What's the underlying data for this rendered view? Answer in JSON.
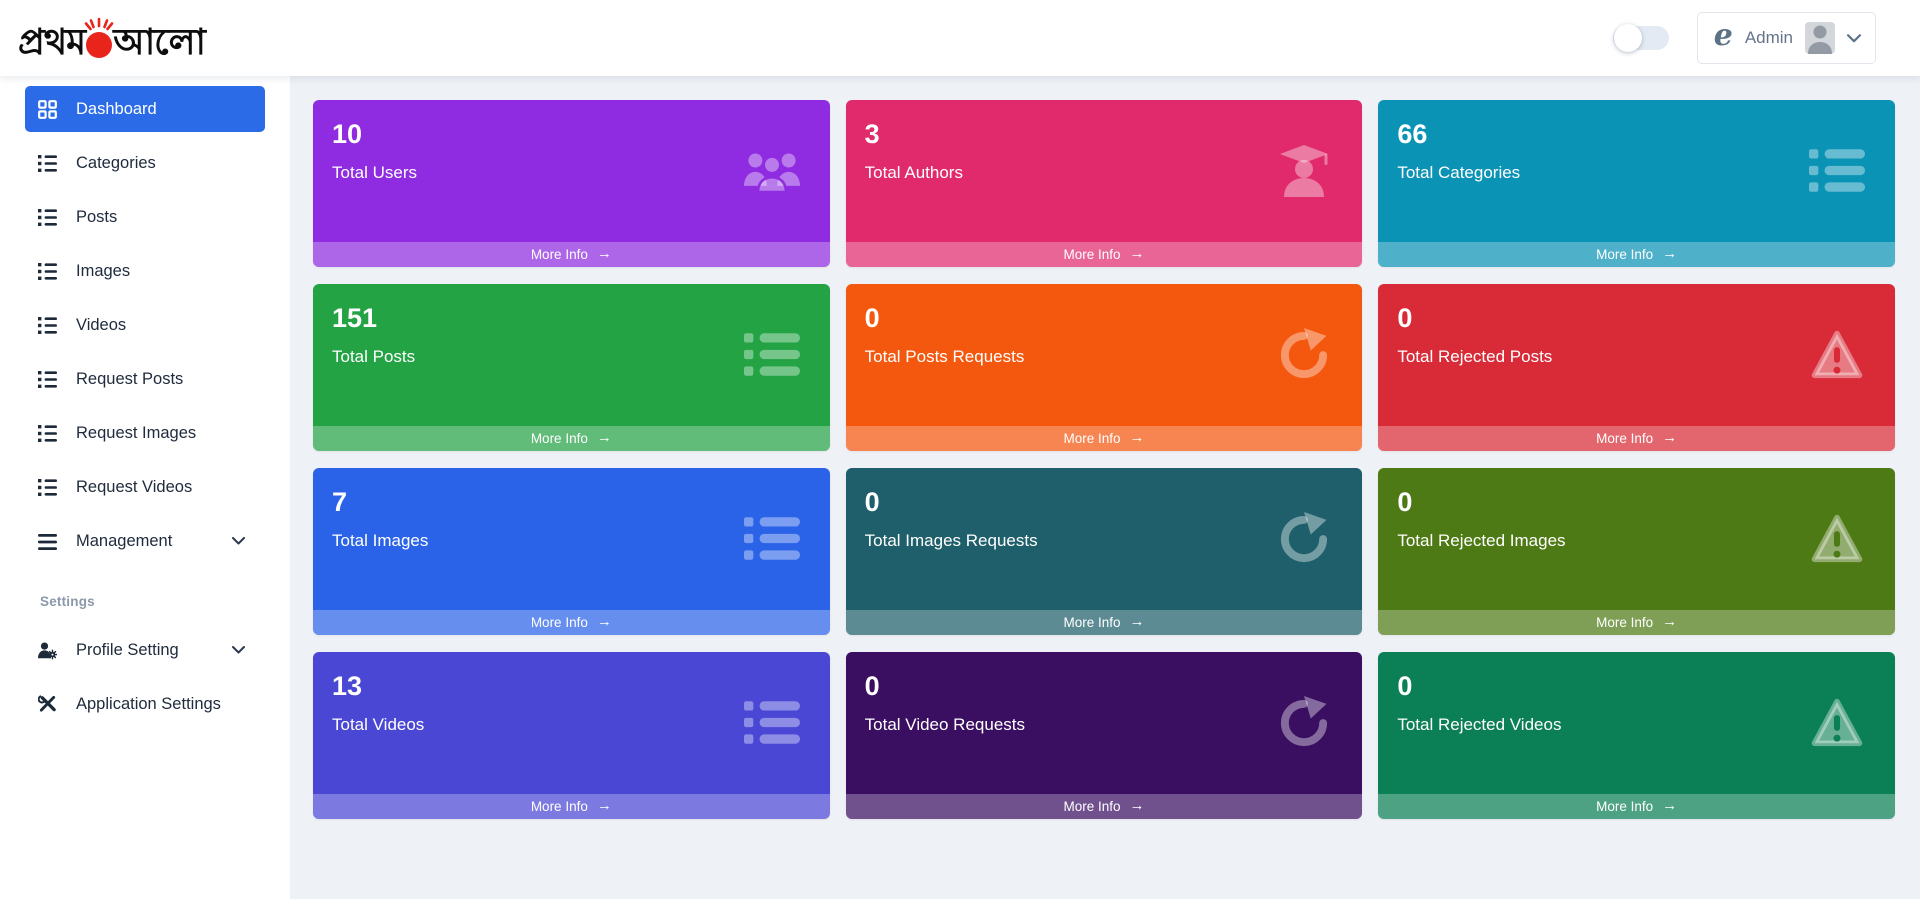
{
  "brand": {
    "text_left": "প্রথম",
    "text_right": "আলো",
    "sun_color": "#e8241b"
  },
  "header": {
    "admin_label": "Admin"
  },
  "sidebar": {
    "active_color": "#2b6be8",
    "items": [
      {
        "label": "Dashboard"
      },
      {
        "label": "Categories"
      },
      {
        "label": "Posts"
      },
      {
        "label": "Images"
      },
      {
        "label": "Videos"
      },
      {
        "label": "Request Posts"
      },
      {
        "label": "Request Images"
      },
      {
        "label": "Request Videos"
      },
      {
        "label": "Management"
      }
    ],
    "section_label": "Settings",
    "settings_items": [
      {
        "label": "Profile Setting"
      },
      {
        "label": "Application Settings"
      }
    ]
  },
  "cards": [
    {
      "value": "10",
      "label": "Total Users",
      "color": "#8f2be0"
    },
    {
      "value": "3",
      "label": "Total Authors",
      "color": "#e02a6c"
    },
    {
      "value": "66",
      "label": "Total Categories",
      "color": "#0b93b5"
    },
    {
      "value": "151",
      "label": "Total Posts",
      "color": "#23a344"
    },
    {
      "value": "0",
      "label": "Total Posts Requests",
      "color": "#f4570e"
    },
    {
      "value": "0",
      "label": "Total Rejected Posts",
      "color": "#d92b37"
    },
    {
      "value": "7",
      "label": "Total Images",
      "color": "#2b63e8"
    },
    {
      "value": "0",
      "label": "Total Images Requests",
      "color": "#1f5f6b"
    },
    {
      "value": "0",
      "label": "Total Rejected Images",
      "color": "#4e7a16"
    },
    {
      "value": "13",
      "label": "Total Videos",
      "color": "#4a47d5"
    },
    {
      "value": "0",
      "label": "Total Video Requests",
      "color": "#3a0f61"
    },
    {
      "value": "0",
      "label": "Total Rejected Videos",
      "color": "#0b7f55"
    }
  ],
  "more_info_label": "More Info",
  "icons": {
    "arrow_right": "→"
  }
}
